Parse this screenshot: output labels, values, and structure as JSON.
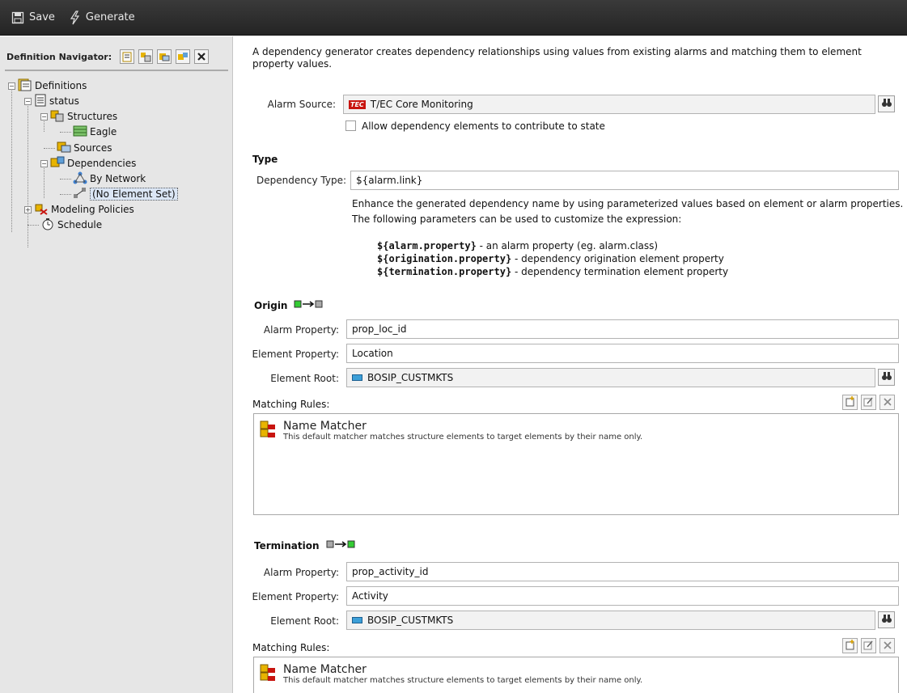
{
  "toolbar": {
    "save_label": "Save",
    "generate_label": "Generate"
  },
  "navigator": {
    "title": "Definition Navigator:",
    "tree": {
      "definitions": "Definitions",
      "status": "status",
      "structures": "Structures",
      "eagle": "Eagle",
      "sources": "Sources",
      "dependencies": "Dependencies",
      "by_network": "By Network",
      "no_element_set": "(No Element Set)",
      "modeling_policies": "Modeling Policies",
      "schedule": "Schedule"
    }
  },
  "main": {
    "intro": "A dependency generator creates dependency relationships using values from existing alarms and matching them to element property values.",
    "alarm_source": {
      "label": "Alarm Source:",
      "value": "T/EC Core Monitoring",
      "badge": "TEC"
    },
    "allow_checkbox_label": "Allow dependency elements to contribute to state",
    "type": {
      "heading": "Type",
      "dependency_type_label": "Dependency Type:",
      "dependency_type_value": "${alarm.link}",
      "help_line1": "Enhance the generated dependency name by using parameterized values based on element or alarm properties.",
      "help_line2": "The following parameters can be used to customize the expression:",
      "params": [
        {
          "code": "${alarm.property}",
          "desc": " - an alarm property (eg. alarm.class)"
        },
        {
          "code": "${origination.property}",
          "desc": " - dependency origination element property"
        },
        {
          "code": "${termination.property}",
          "desc": " - dependency termination element property"
        }
      ]
    },
    "origin": {
      "heading": "Origin",
      "alarm_property_label": "Alarm Property:",
      "alarm_property_value": "prop_loc_id",
      "element_property_label": "Element Property:",
      "element_property_value": "Location",
      "element_root_label": "Element Root:",
      "element_root_value": "BOSIP_CUSTMKTS",
      "matching_rules_label": "Matching Rules:",
      "matcher_title": "Name Matcher",
      "matcher_desc": "This default matcher matches structure elements to target elements by their name only."
    },
    "termination": {
      "heading": "Termination",
      "alarm_property_label": "Alarm Property:",
      "alarm_property_value": "prop_activity_id",
      "element_property_label": "Element Property:",
      "element_property_value": "Activity",
      "element_root_label": "Element Root:",
      "element_root_value": "BOSIP_CUSTMKTS",
      "matching_rules_label": "Matching Rules:",
      "matcher_title": "Name Matcher",
      "matcher_desc": "This default matcher matches structure elements to target elements by their name only."
    }
  },
  "colors": {
    "toolbar_bg": "#2e2e2e",
    "nav_bg": "#e6e6e6",
    "tec_red": "#c8140f",
    "origin_green": "#33cc33",
    "element_blue": "#3c9fd8"
  }
}
